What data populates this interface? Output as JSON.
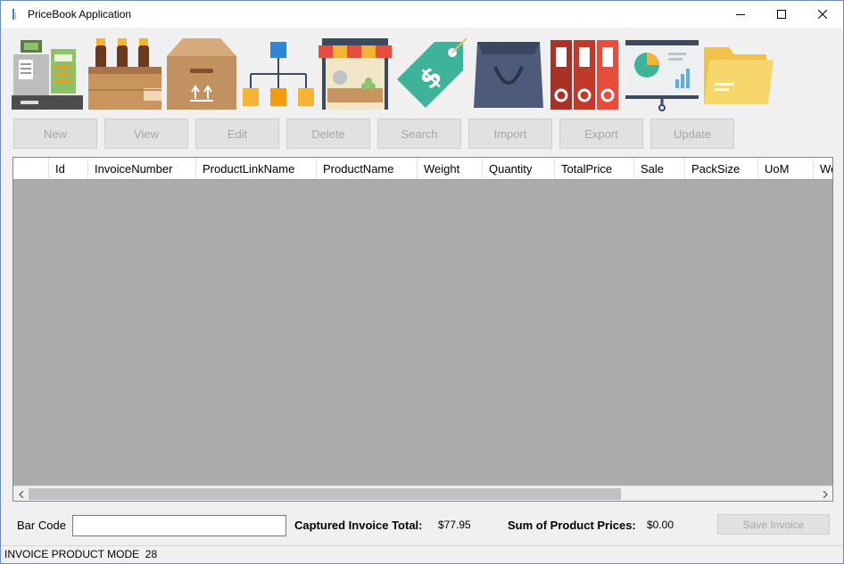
{
  "window": {
    "title": "PriceBook Application"
  },
  "toolbar": {
    "icons": [
      "cash-register-icon",
      "beer-crate-icon",
      "cardboard-box-icon",
      "hierarchy-icon",
      "market-stall-icon",
      "price-tag-icon",
      "shopping-bag-icon",
      "binders-icon",
      "presentation-board-icon",
      "folder-icon"
    ]
  },
  "actions": {
    "new": "New",
    "view": "View",
    "edit": "Edit",
    "delete": "Delete",
    "search": "Search",
    "import": "Import",
    "export": "Export",
    "update": "Update"
  },
  "grid": {
    "columns": [
      "",
      "Id",
      "InvoiceNumber",
      "ProductLinkName",
      "ProductName",
      "Weight",
      "Quantity",
      "TotalPrice",
      "Sale",
      "PackSize",
      "UoM",
      "We"
    ],
    "rows": []
  },
  "footer": {
    "barcode_label": "Bar Code",
    "barcode_value": "",
    "captured_total_label": "Captured Invoice Total:",
    "captured_total_value": "$77.95",
    "sum_label": "Sum of Product Prices:",
    "sum_value": "$0.00",
    "save_label": "Save Invoice"
  },
  "status": {
    "text": "INVOICE PRODUCT MODE  28"
  }
}
